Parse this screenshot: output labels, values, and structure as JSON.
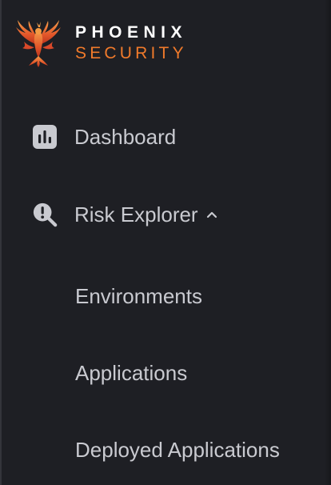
{
  "brand": {
    "line1": "PHOENIX",
    "line2": "SECURITY",
    "line1_color": "#ffffff",
    "line2_color": "#f07a2b",
    "logo_icon": "phoenix-bird-icon"
  },
  "nav": {
    "items": [
      {
        "label": "Dashboard",
        "icon": "bar-chart-icon"
      },
      {
        "label": "Risk Explorer",
        "icon": "search-alert-icon",
        "expanded": true,
        "chevron": "chevron-up-icon"
      }
    ],
    "sub_items": [
      {
        "label": "Environments"
      },
      {
        "label": "Applications"
      },
      {
        "label": "Deployed Applications"
      }
    ]
  },
  "colors": {
    "background": "#1e1f24",
    "text": "#c9cad0",
    "icon": "#c9cad0",
    "accent": "#f07a2b"
  }
}
